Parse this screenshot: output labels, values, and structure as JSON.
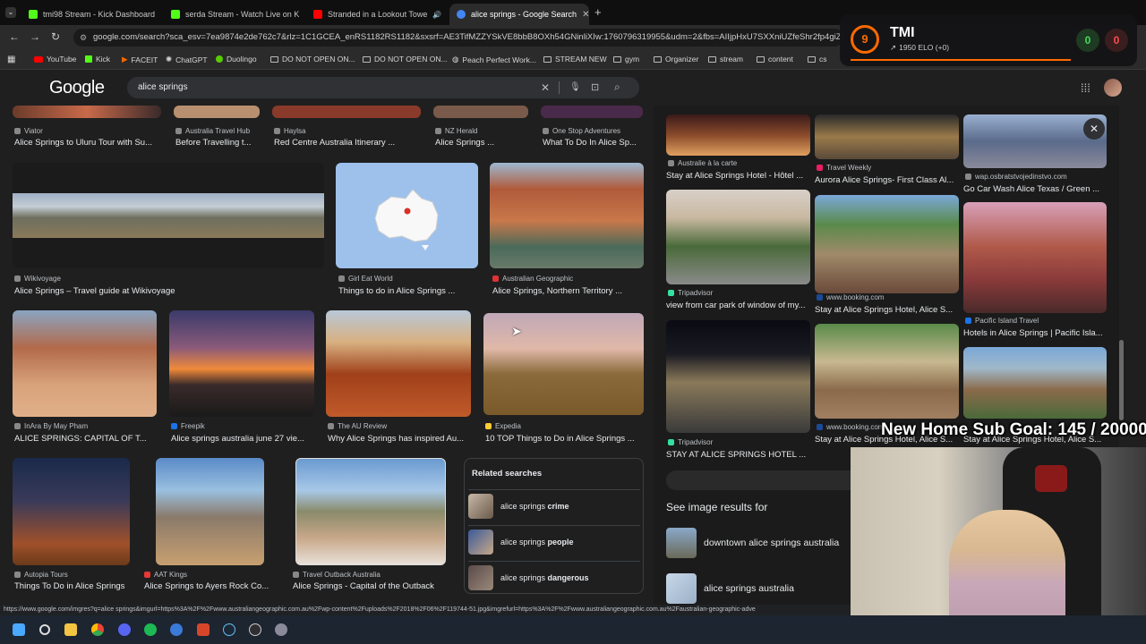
{
  "tabs": [
    {
      "title": "tmi98 Stream - Kick Dashboard",
      "color": "#53fc18"
    },
    {
      "title": "serda Stream - Watch Live on K",
      "color": "#53fc18"
    },
    {
      "title": "Stranded in a Lookout Towe",
      "color": "#ff0000"
    },
    {
      "title": "alice springs - Google Search",
      "color": "#4285f4"
    }
  ],
  "url": "google.com/search?sca_esv=7ea9874e2de762c7&rlz=1C1GCEA_enRS1182RS1182&sxsrf=AE3TifMZZYSkVE8bbB8OXh54GNinliXIw:1760796319955&udm=2&fbs=AIIjpHxU7SXXniUZfeShr2fp4giZ1Y6MJ25",
  "bookmarks": [
    "YouTube",
    "Kick",
    "FACEIT",
    "ChatGPT",
    "Duolingo",
    "DO NOT OPEN ON...",
    "DO NOT OPEN ON...",
    "Peach Perfect Work...",
    "STREAM NEW",
    "gym",
    "Organizer",
    "stream",
    "content",
    "cs"
  ],
  "search": {
    "logo": "Google",
    "query": "alice springs"
  },
  "results": [
    {
      "source": "Viator",
      "title": "Alice Springs to Uluru Tour with Su..."
    },
    {
      "source": "Australia Travel Hub",
      "title": "Before Travelling t..."
    },
    {
      "source": "Haylsa",
      "title": "Red Centre Australia Itinerary ..."
    },
    {
      "source": "NZ Herald",
      "title": "Alice Springs ..."
    },
    {
      "source": "One Stop Adventures",
      "title": "What To Do In Alice Sp..."
    },
    {
      "source": "Wikivoyage",
      "title": "Alice Springs – Travel guide at Wikivoyage"
    },
    {
      "source": "Girl Eat World",
      "title": "Things to do in Alice Springs ..."
    },
    {
      "source": "Australian Geographic",
      "title": "Alice Springs, Northern Territory ..."
    },
    {
      "source": "InAra By May Pham",
      "title": "ALICE SPRINGS: CAPITAL OF T..."
    },
    {
      "source": "Freepik",
      "title": "Alice springs australia june 27 vie..."
    },
    {
      "source": "The AU Review",
      "title": "Why Alice Springs has inspired Au..."
    },
    {
      "source": "Expedia",
      "title": "10 TOP Things to Do in Alice Springs ..."
    },
    {
      "source": "Autopia Tours",
      "title": "Things To Do in Alice Springs"
    },
    {
      "source": "AAT Kings",
      "title": "Alice Springs to Ayers Rock Co..."
    },
    {
      "source": "Travel Outback Australia",
      "title": "Alice Springs - Capital of the Outback"
    }
  ],
  "related": {
    "heading": "Related searches",
    "items": [
      {
        "prefix": "alice springs ",
        "bold": "crime"
      },
      {
        "prefix": "alice springs ",
        "bold": "people"
      },
      {
        "prefix": "alice springs ",
        "bold": "dangerous"
      }
    ]
  },
  "side": [
    {
      "source": "Australie à la carte",
      "title": "Stay at Alice Springs Hotel - Hôtel ..."
    },
    {
      "source": "Travel Weekly",
      "title": "Aurora Alice Springs- First Class Al..."
    },
    {
      "source": "wap.osbratstvojedinstvo.com",
      "title": "Go Car Wash Alice Texas / Green ..."
    },
    {
      "source": "Tripadvisor",
      "title": "view from car park of window of my..."
    },
    {
      "source": "www.booking.com",
      "title": "Stay at Alice Springs Hotel, Alice S..."
    },
    {
      "source": "Pacific Island Travel",
      "title": "Hotels in Alice Springs | Pacific Isla..."
    },
    {
      "source": "Tripadvisor",
      "title": "STAY AT ALICE SPRINGS HOTEL ..."
    },
    {
      "source": "www.booking.com",
      "title": "Stay at Alice Springs Hotel, Alice S..."
    },
    {
      "source": "",
      "title": "Stay at Alice Springs Hotel, Alice S..."
    }
  ],
  "see_results": {
    "heading": "See image results for",
    "items": [
      "downtown alice springs australia",
      "alice springs australia"
    ]
  },
  "overlay": {
    "rank": "9",
    "name": "TMI",
    "elo": "1950 ELO (+0)",
    "wins": "0",
    "losses": "0",
    "goal": "New Home Sub Goal:  145 / 20000"
  },
  "status_url": "https://www.google.com/imgres?q=alice springs&imgurl=https%3A%2F%2Fwww.australiangeographic.com.au%2Fwp-content%2Fuploads%2F2018%2F06%2F119744-51.jpg&imgrefurl=https%3A%2F%2Fwww.australiangeographic.com.au%2Faustralian-geographic-adve"
}
